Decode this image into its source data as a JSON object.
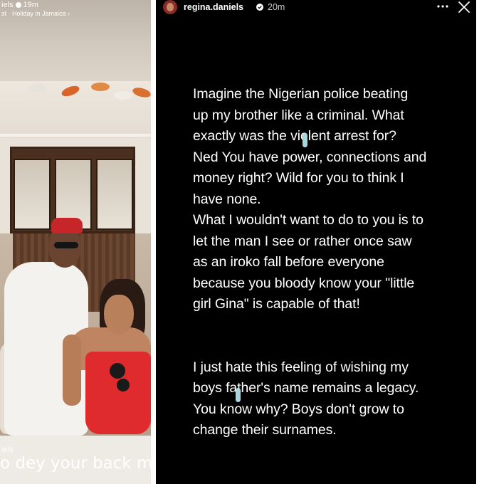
{
  "left_story": {
    "username_fragment": "iels",
    "time": "19m",
    "subtitle": "st · Holiday in Jamaica ›",
    "footer_username": "iels",
    "caption": "o dey your back my br"
  },
  "right_story": {
    "username": "regina.daniels",
    "time": "20m",
    "more_icon": "more-horizontal-icon",
    "close_icon": "close-icon",
    "paragraph_1": "Imagine the Nigerian police beating\nup my brother like a criminal. What\nexactly was the violent arrest for?\nNed You have power, connections and\nmoney right? Wild for you to think I\nhave none.\nWhat I wouldn't want to do to you is to\nlet the man I see or rather once saw\nas an iroko fall before everyone\nbecause you bloody know your \"little\ngirl Gina\" is capable of that!",
    "paragraph_2": "I just hate this feeling of wishing my\nboys father's name remains a legacy.\nYou know why? Boys don't grow to\nchange their surnames."
  },
  "colors": {
    "story_background": "#000000",
    "text": "#ffffff",
    "dress_red": "#df2a2e",
    "cap_red": "#c6262a",
    "highlight_mark": "#a8d6e0"
  }
}
